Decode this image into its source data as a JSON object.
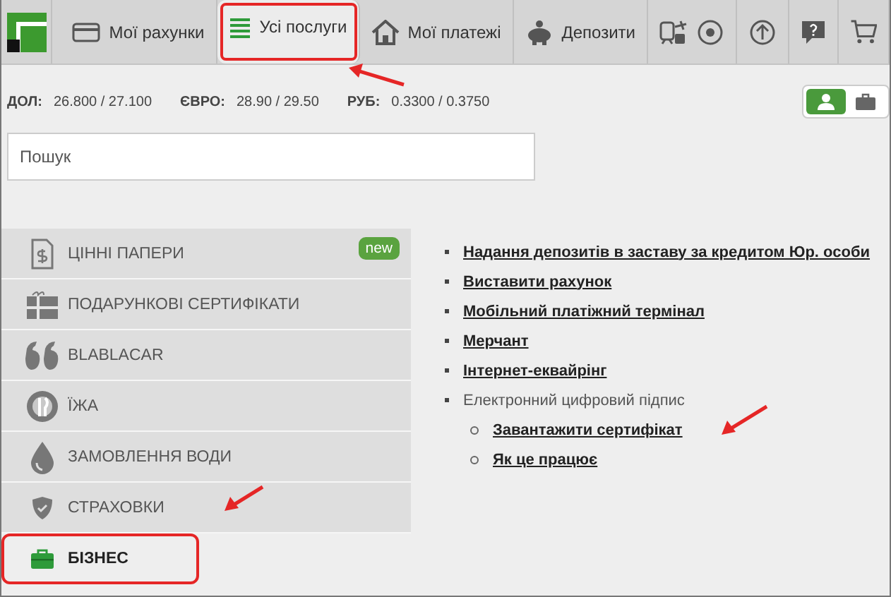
{
  "nav": {
    "tabs": [
      {
        "kind": "card",
        "label": "Мої рахунки",
        "selected": false,
        "highlighted": false
      },
      {
        "kind": "list",
        "label": "Усі послуги",
        "selected": true,
        "highlighted": true
      },
      {
        "kind": "house",
        "label": "Мої платежі",
        "selected": false,
        "highlighted": false
      },
      {
        "kind": "piggy",
        "label": "Депозити",
        "selected": false,
        "highlighted": false
      },
      {
        "kind": "travel",
        "selected": false,
        "highlighted": false
      },
      {
        "kind": "arrow",
        "selected": false,
        "highlighted": false
      },
      {
        "kind": "help",
        "selected": false,
        "highlighted": false
      },
      {
        "kind": "cart",
        "selected": false,
        "highlighted": false
      }
    ]
  },
  "rates": [
    {
      "currency": "ДОЛ:",
      "value": "26.800 / 27.100"
    },
    {
      "currency": "ЄВРО:",
      "value": "28.90 / 29.50"
    },
    {
      "currency": "РУБ:",
      "value": "0.3300 / 0.3750"
    }
  ],
  "profile_toggle": [
    {
      "kind": "person",
      "selected": true
    },
    {
      "kind": "business",
      "selected": false
    }
  ],
  "search": {
    "placeholder": "Пошук"
  },
  "menu": [
    {
      "kind": "document",
      "label": "ЦІННІ ПАПЕРИ",
      "badge": "new",
      "selected": false,
      "highlighted": false
    },
    {
      "kind": "gift",
      "label": "ПОДАРУНКОВІ СЕРТИФІКАТИ",
      "selected": false,
      "highlighted": false
    },
    {
      "kind": "quote",
      "label": "BLABLACAR",
      "selected": false,
      "highlighted": false
    },
    {
      "kind": "food",
      "label": "ЇЖА",
      "selected": false,
      "highlighted": false
    },
    {
      "kind": "drop",
      "label": "ЗАМОВЛЕННЯ ВОДИ",
      "selected": false,
      "highlighted": false
    },
    {
      "kind": "shield",
      "label": "СТРАХОВКИ",
      "selected": false,
      "highlighted": false
    },
    {
      "kind": "briefcase",
      "label": "БІЗНЕС",
      "selected": true,
      "highlighted": true
    }
  ],
  "services": [
    {
      "label": "Надання депозитів в заставу за кредитом Юр. особи",
      "link": true
    },
    {
      "label": "Виставити рахунок",
      "link": true
    },
    {
      "label": "Мобільний платіжний термінал",
      "link": true
    },
    {
      "label": "Мерчант",
      "link": true
    },
    {
      "label": "Інтернет-еквайрінг",
      "link": true
    },
    {
      "label": "Електронний цифровий підпис",
      "link": false,
      "children": [
        {
          "label": "Завантажити сертифікат",
          "link": true
        },
        {
          "label": "Як це працює",
          "link": true
        }
      ]
    }
  ]
}
